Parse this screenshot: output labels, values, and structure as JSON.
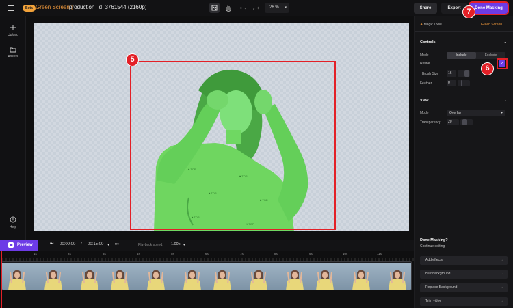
{
  "topbar": {
    "beta_badge": "Beta",
    "project_prefix": "Green Screen |",
    "project_name": "production_id_3761544 (2160p)",
    "zoom_level": "26 %",
    "share_label": "Share",
    "export_label": "Export",
    "done_masking_label": "Done Masking"
  },
  "leftrail": {
    "items": [
      {
        "label": "Upload",
        "icon": "plus-icon"
      },
      {
        "label": "Assets",
        "icon": "folder-icon"
      },
      {
        "label": "Help",
        "icon": "help-icon"
      }
    ]
  },
  "callouts": {
    "canvas_badge": "5",
    "refine_badge": "6",
    "done_badge": "7"
  },
  "rightpanel": {
    "header_title": "Magic Tools",
    "header_tab": "Green Screen",
    "controls_title": "Controls",
    "mode_label": "Mode",
    "mode_include": "Include",
    "mode_exclude": "Exclude",
    "refine_label": "Refine",
    "refine_check": "✓",
    "brush_size_label": "Brush Size",
    "brush_size_value": "16",
    "feather_label": "Feather",
    "feather_value": "0",
    "view_title": "View",
    "view_mode_label": "Mode",
    "view_mode_value": "Overlay",
    "transparency_label": "Transparency",
    "transparency_value": "20",
    "done_title": "Done Masking?",
    "done_subtitle": "Continue editing",
    "actions": [
      {
        "label": "Add effects"
      },
      {
        "label": "Blur background"
      },
      {
        "label": "Replace Background"
      },
      {
        "label": "Trim video"
      }
    ]
  },
  "playbar": {
    "preview_label": "Preview",
    "current_time": "00:00.00",
    "separator": "/",
    "total_time": "00:15.00",
    "playback_speed_label": "Playback speed:",
    "playback_speed_value": "1.00x"
  },
  "ruler": {
    "ticks": [
      "1s",
      "2s",
      "3s",
      "4s",
      "5s",
      "6s",
      "7s",
      "8s",
      "9s",
      "10s",
      "11s"
    ]
  },
  "colors": {
    "accent": "#6d3be6",
    "callout": "#e32027",
    "mask": "#5fd05a",
    "brand_orange": "#f29a3c"
  }
}
